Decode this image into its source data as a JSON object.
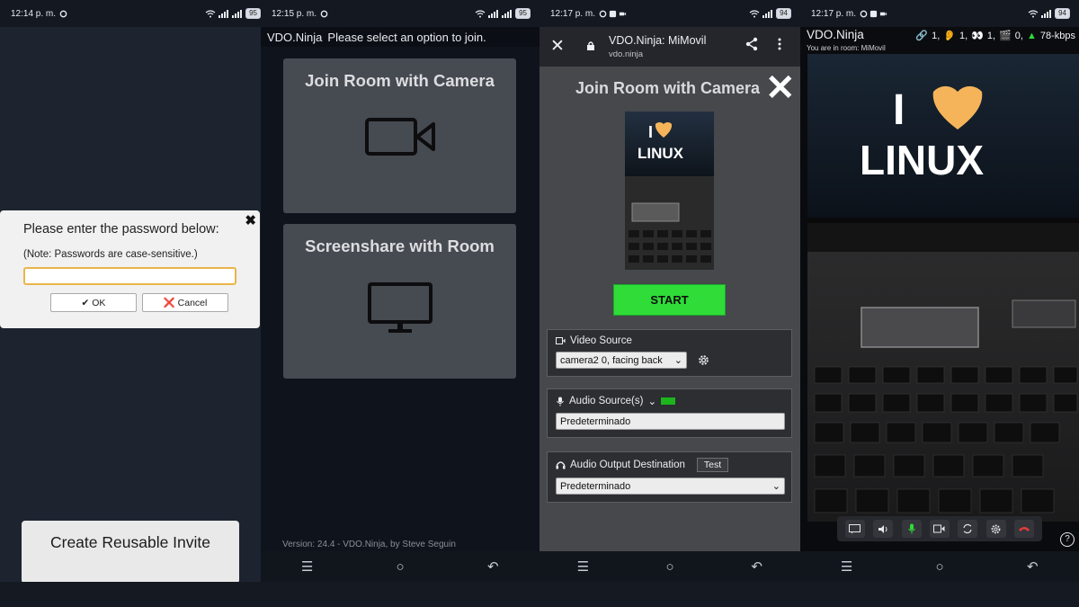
{
  "phones": [
    {
      "status": {
        "time": "12:14 p. m.",
        "battery": "95"
      },
      "password_dialog": {
        "title": "Please enter the password below:",
        "note": "(Note: Passwords are case-sensitive.)",
        "input_value": "",
        "ok_label": "✔ OK",
        "cancel_label": "❌ Cancel",
        "close_symbol": "✖"
      },
      "invite_card": {
        "title": "Create Reusable Invite"
      }
    },
    {
      "status": {
        "time": "12:15 p. m.",
        "battery": "95"
      },
      "header": {
        "brand": "VDO.Ninja",
        "prompt": "Please select an option to join."
      },
      "options": [
        {
          "label": "Join Room with Camera",
          "icon": "camera-icon"
        },
        {
          "label": "Screenshare with Room",
          "icon": "monitor-icon"
        }
      ],
      "version": "Version: 24.4 - VDO.Ninja, by Steve Seguin"
    },
    {
      "status": {
        "time": "12:17 p. m.",
        "battery": "94"
      },
      "browser": {
        "page_title": "VDO.Ninja: MiMovil",
        "domain": "vdo.ninja"
      },
      "title": "Join Room with Camera",
      "start_label": "START",
      "video_source": {
        "label": "Video Source",
        "selected": "camera2 0, facing back"
      },
      "audio_source": {
        "label": "Audio Source(s)",
        "selected": "Predeterminado"
      },
      "audio_output": {
        "label": "Audio Output Destination",
        "test_label": "Test",
        "selected": "Predeterminado"
      },
      "preview_text": {
        "line1": "I",
        "line2": "LINUX"
      }
    },
    {
      "status": {
        "time": "12:17 p. m.",
        "battery": "94"
      },
      "brand": "VDO.Ninja",
      "room_text": "You are in room: MiMovil",
      "stats": {
        "links": "1,",
        "ears": "1,",
        "eyes": "1,",
        "clap": "0,",
        "bitrate": "78-kbps"
      },
      "video_text": {
        "line1": "I",
        "line2": "LINUX"
      },
      "help": "?"
    }
  ],
  "colors": {
    "start_green": "#2fdc38",
    "hangup_red": "#e23b3b",
    "heart": "#f6b45a"
  }
}
